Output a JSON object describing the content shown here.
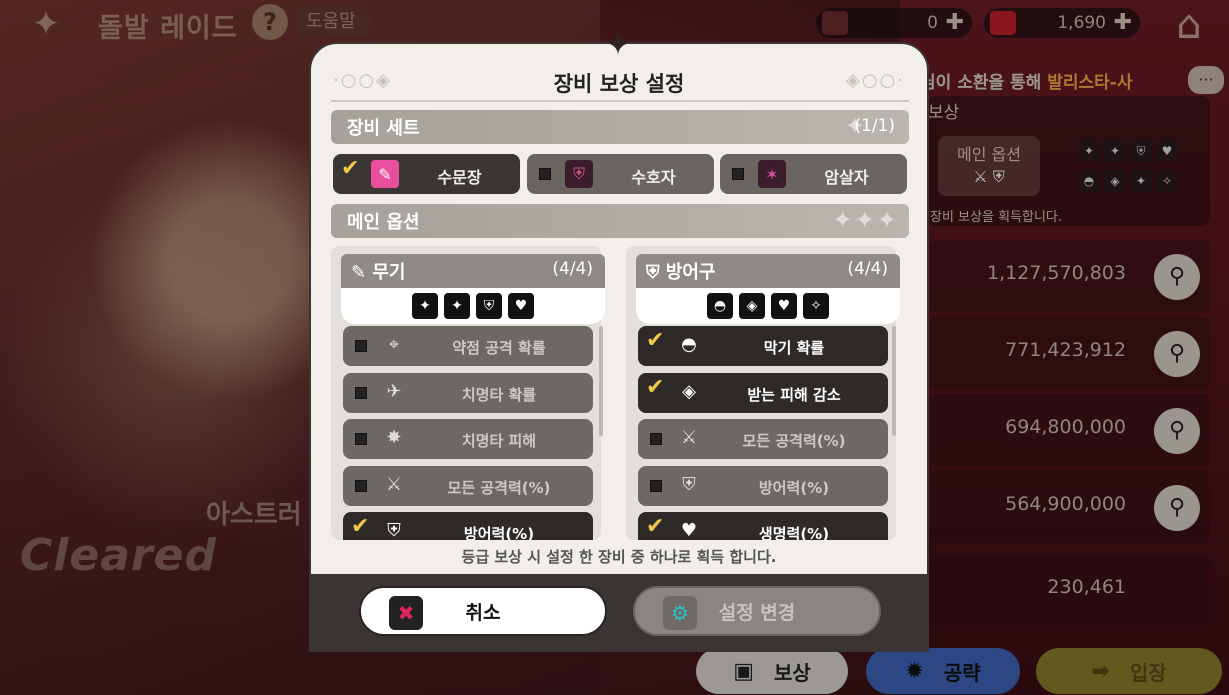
{
  "topbar": {
    "title": "돌발 레이드",
    "help_label": "도움말",
    "currency1_value": "0",
    "currency2_value": "1,690"
  },
  "ticker": {
    "text": "님이 소환을 통해 ",
    "highlight": "발리스타-사"
  },
  "reward_panel": {
    "title": "보상",
    "main_option_label": "메인 옵션",
    "note": "장비 보상을 획득합니다."
  },
  "ranking_scores": [
    "1,127,570,803",
    "771,423,912",
    "694,800,000",
    "564,900,000",
    "230,461"
  ],
  "boss": {
    "name": "아스트러",
    "status": "Cleared"
  },
  "bottom_buttons": {
    "reward": "보상",
    "strategy": "공략",
    "enter": "입장"
  },
  "modal": {
    "title": "장비 보상 설정",
    "equipment_set": {
      "label": "장비 세트",
      "count": "(1/1)",
      "sets": [
        {
          "label": "수문장",
          "checked": true,
          "icon": "gatekeeper-icon",
          "color": "#e94f9d"
        },
        {
          "label": "수호자",
          "checked": false,
          "icon": "guardian-shield-icon",
          "color": "#c95a8a"
        },
        {
          "label": "암살자",
          "checked": false,
          "icon": "assassin-icon",
          "color": "#d94fa8"
        }
      ]
    },
    "main_option": {
      "label": "메인 옵션",
      "weapon": {
        "label": "무기",
        "count": "(4/4)",
        "items": [
          {
            "label": "약점 공격 확률",
            "checked": false
          },
          {
            "label": "치명타 확률",
            "checked": false
          },
          {
            "label": "치명타 피해",
            "checked": false
          },
          {
            "label": "모든 공격력(%)",
            "checked": false
          },
          {
            "label": "방어력(%)",
            "checked": true
          }
        ]
      },
      "armor": {
        "label": "방어구",
        "count": "(4/4)",
        "items": [
          {
            "label": "막기 확률",
            "checked": true
          },
          {
            "label": "받는 피해 감소",
            "checked": true
          },
          {
            "label": "모든 공격력(%)",
            "checked": false
          },
          {
            "label": "방어력(%)",
            "checked": false
          },
          {
            "label": "생명력(%)",
            "checked": true
          }
        ]
      }
    },
    "footnote": "등급 보상 시 설정 한 장비 중 하나로 획득 합니다.",
    "cancel_label": "취소",
    "confirm_label": "설정 변경"
  }
}
